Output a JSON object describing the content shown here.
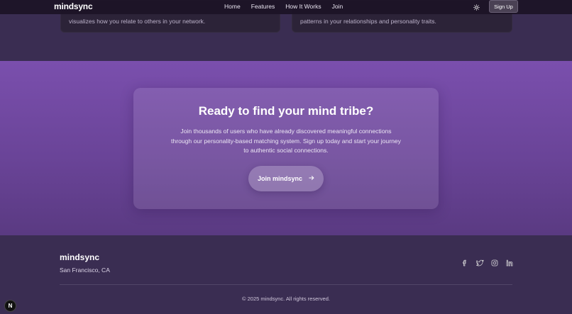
{
  "nav": {
    "brand": "mindsync",
    "links": [
      "Home",
      "Features",
      "How It Works",
      "Join"
    ],
    "theme_icon": "sun-icon",
    "signup_label": "Sign Up"
  },
  "cards": {
    "left_text": "visualizes how you relate to others in your network.",
    "right_text": "patterns in your relationships and personality traits."
  },
  "cta": {
    "title": "Ready to find your mind tribe?",
    "body": "Join thousands of users who have already discovered meaningful connections through our personality-based matching system. Sign up today and start your journey to authentic social connections.",
    "button_label": "Join mindsync",
    "button_icon": "arrow-right-icon"
  },
  "footer": {
    "brand": "mindsync",
    "location": "San Francisco, CA",
    "socials": [
      "facebook-icon",
      "twitter-icon",
      "instagram-icon",
      "linkedin-icon"
    ],
    "copyright": "© 2025 mindsync. All rights reserved."
  },
  "colors": {
    "cta_gradient_top": "#7a4fad",
    "cta_gradient_bottom": "#5a3a82",
    "footer_bg": "#3a2d52",
    "navbar_bg": "#1c1426"
  }
}
